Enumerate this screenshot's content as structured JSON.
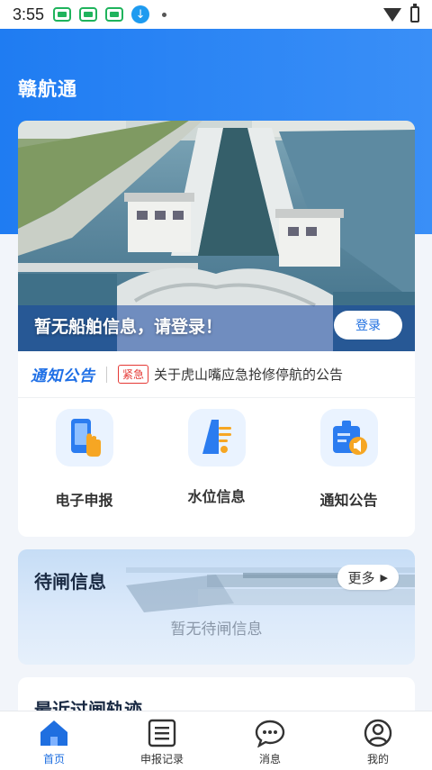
{
  "status_bar": {
    "time": "3:55",
    "icons": [
      "app-icon",
      "app-icon",
      "app-icon",
      "download-icon",
      "dot-icon",
      "wifi-icon",
      "battery-icon"
    ]
  },
  "app": {
    "title": "赣航通",
    "accent": "#1f7cf2"
  },
  "banner": {
    "message": "暂无船舶信息，请登录！",
    "login_label": "登录"
  },
  "notice": {
    "logo_main": "通知",
    "logo_sub": "公告",
    "tag": "紧急",
    "text": "关于虎山嘴应急抢修停航的公告"
  },
  "quick_actions": [
    {
      "label": "电子申报",
      "icon": "phone-tap-icon"
    },
    {
      "label": "水位信息",
      "icon": "water-level-icon"
    },
    {
      "label": "通知公告",
      "icon": "announcement-icon"
    }
  ],
  "waiting": {
    "title": "待闸信息",
    "more_label": "更多",
    "empty_text": "暂无待闸信息"
  },
  "recent": {
    "title": "最近过闸轨迹"
  },
  "tabs": [
    {
      "label": "首页",
      "icon": "home-icon",
      "active": true
    },
    {
      "label": "申报记录",
      "icon": "list-icon",
      "active": false
    },
    {
      "label": "消息",
      "icon": "message-icon",
      "active": false
    },
    {
      "label": "我的",
      "icon": "profile-icon",
      "active": false
    }
  ]
}
